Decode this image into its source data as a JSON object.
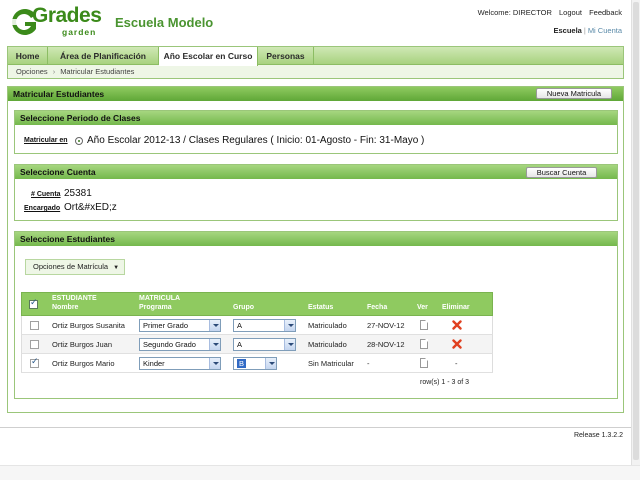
{
  "header": {
    "logo_word": "Grades",
    "logo_sub": "garden",
    "school": "Escuela Modelo",
    "welcome": "Welcome: DIRECTOR",
    "logout": "Logout",
    "feedback": "Feedback",
    "current_school": "Escuela",
    "my_account": "Mi Cuenta"
  },
  "nav": {
    "tabs": [
      "Home",
      "Área de Planificación",
      "Año Escolar en Curso",
      "Personas"
    ],
    "breadcrumb": [
      "Opciones",
      "Matricular Estudiantes"
    ]
  },
  "main": {
    "title": "Matricular Estudiantes",
    "new_button": "Nueva Matricula"
  },
  "period": {
    "title": "Seleccione Periodo de Clases",
    "label": "Matricular en",
    "value": "Año Escolar 2012-13 / Clases Regulares ( Inicio: 01-Agosto - Fin: 31-Mayo )"
  },
  "account": {
    "title": "Seleccione Cuenta",
    "search_button": "Buscar Cuenta",
    "number_label": "# Cuenta",
    "number": "25381",
    "guardian_label": "Encargado",
    "guardian": "Ort&#xED;z"
  },
  "students": {
    "title": "Seleccione Estudiantes",
    "options_button": "Opciones de Matrícula",
    "headers": {
      "student_1": "ESTUDIANTE",
      "student_2": "Nombre",
      "enroll_1": "MATRICULA",
      "enroll_2": "Programa",
      "group": "Grupo",
      "status": "Estatus",
      "date": "Fecha",
      "view": "Ver",
      "delete": "Eliminar"
    },
    "rows": [
      {
        "name": "Ortiz Burgos Susanita",
        "program": "Primer Grado",
        "group": "A",
        "status": "Matriculado",
        "date": "27-NOV-12",
        "delete": ""
      },
      {
        "name": "Ortiz Burgos Juan",
        "program": "Segundo Grado",
        "group": "A",
        "status": "Matriculado",
        "date": "28-NOV-12",
        "delete": ""
      },
      {
        "name": "Ortiz Burgos Mario",
        "program": "Kinder",
        "group": "B",
        "status": "Sin Matricular",
        "date": "-",
        "delete": "-"
      }
    ],
    "pager": "row(s) 1 - 3 of 3"
  },
  "footer": {
    "release": "Release 1.3.2.2"
  },
  "colors": {
    "brand_green": "#4a9430",
    "header_green": "#8fca60",
    "delete_red": "#e04020"
  }
}
